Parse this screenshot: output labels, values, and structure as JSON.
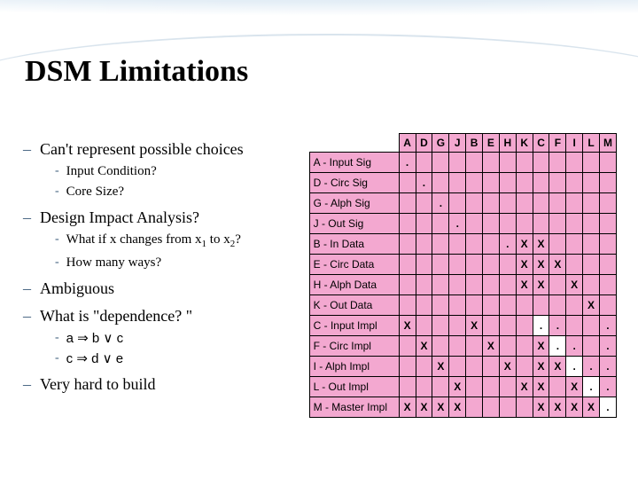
{
  "title": "DSM Limitations",
  "bullets": {
    "b1": "Can't represent possible choices",
    "b1a": "Input Condition?",
    "b1b": "Core Size?",
    "b2": "Design Impact Analysis?",
    "b2a_pre": "What if x changes from x",
    "b2a_s1": "1",
    "b2a_mid": " to x",
    "b2a_s2": "2",
    "b2a_post": "?",
    "b2b": "How many ways?",
    "b3": "Ambiguous",
    "b4": "What is \"dependence? \"",
    "b4a": "a ⇒ b ∨ c",
    "b4b": "c ⇒ d ∨ e",
    "b5": "Very hard to build"
  },
  "chart_data": {
    "type": "table",
    "title": "Design Structure Matrix",
    "columns": [
      "A",
      "D",
      "G",
      "J",
      "B",
      "E",
      "H",
      "K",
      "C",
      "F",
      "I",
      "L",
      "M"
    ],
    "rows": [
      {
        "id": "A",
        "label": "A - Input Sig"
      },
      {
        "id": "D",
        "label": "D - Circ Sig"
      },
      {
        "id": "G",
        "label": "G - Alph Sig"
      },
      {
        "id": "J",
        "label": "J - Out Sig"
      },
      {
        "id": "B",
        "label": "B - In Data"
      },
      {
        "id": "E",
        "label": "E - Circ Data"
      },
      {
        "id": "H",
        "label": "H - Alph Data"
      },
      {
        "id": "K",
        "label": "K - Out Data"
      },
      {
        "id": "C",
        "label": "C - Input Impl"
      },
      {
        "id": "F",
        "label": "F - Circ Impl"
      },
      {
        "id": "I",
        "label": "I - Alph Impl"
      },
      {
        "id": "L",
        "label": "L - Out Impl"
      },
      {
        "id": "M",
        "label": "M - Master Impl"
      }
    ],
    "block_starts": [
      "A",
      "B",
      "C"
    ],
    "diag_blocks": {
      "C": [
        "C"
      ],
      "F": [
        "F"
      ],
      "I": [
        "I"
      ],
      "L": [
        "L"
      ],
      "M": [
        "M"
      ]
    },
    "deps": {
      "B": {
        "H": ".",
        "K": "X",
        "C": "X"
      },
      "E": {
        "K": "X",
        "C": "X",
        "F": "X"
      },
      "H": {
        "K": "X",
        "C": "X",
        "I": "X"
      },
      "K": {
        "L": "X"
      },
      "C": {
        "A": "X",
        "B": "X",
        "F": ".",
        "M": "."
      },
      "F": {
        "D": "X",
        "E": "X",
        "C": "X",
        "I": ".",
        "M": "."
      },
      "I": {
        "G": "X",
        "H": "X",
        "C": "X",
        "F": "X",
        "L": ".",
        "M": "."
      },
      "L": {
        "J": "X",
        "K": "X",
        "C": "X",
        "I": "X",
        "M": "."
      },
      "M": {
        "A": "X",
        "D": "X",
        "G": "X",
        "J": "X",
        "C": "X",
        "F": "X",
        "I": "X",
        "L": "X"
      }
    },
    "self_dots": [
      "A",
      "D",
      "G",
      "J"
    ]
  }
}
